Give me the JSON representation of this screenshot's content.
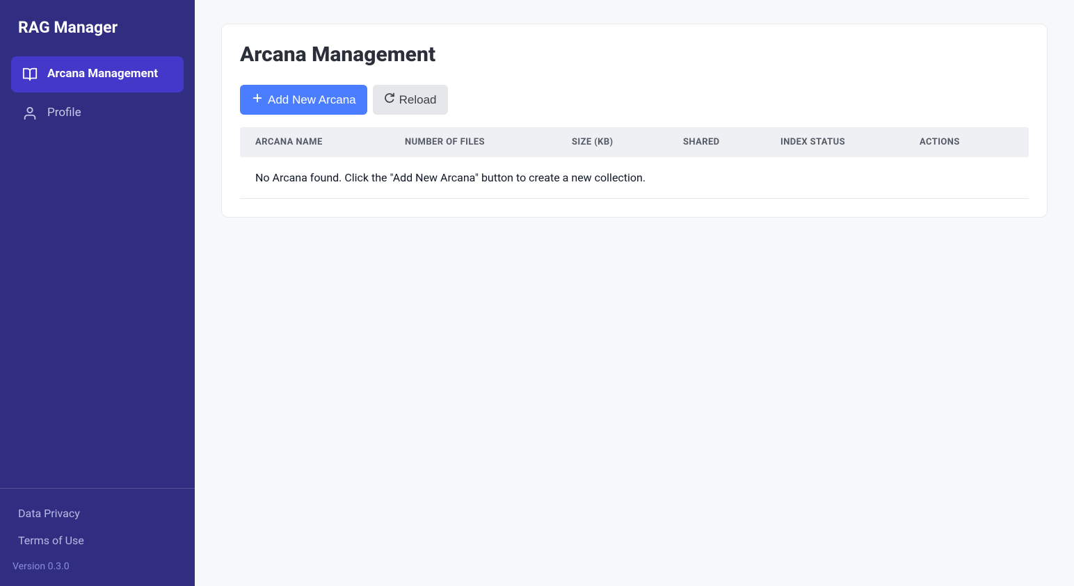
{
  "sidebar": {
    "title": "RAG Manager",
    "nav": [
      {
        "label": "Arcana Management",
        "icon": "book",
        "active": true
      },
      {
        "label": "Profile",
        "icon": "user",
        "active": false
      }
    ],
    "footer_links": [
      {
        "label": "Data Privacy"
      },
      {
        "label": "Terms of Use"
      }
    ],
    "version": "Version 0.3.0"
  },
  "main": {
    "title": "Arcana Management",
    "buttons": {
      "add": "Add New Arcana",
      "reload": "Reload"
    },
    "table": {
      "columns": [
        "Arcana Name",
        "Number of Files",
        "Size (KB)",
        "Shared",
        "Index Status",
        "Actions"
      ],
      "empty_message": "No Arcana found. Click the \"Add New Arcana\" button to create a new collection."
    }
  }
}
